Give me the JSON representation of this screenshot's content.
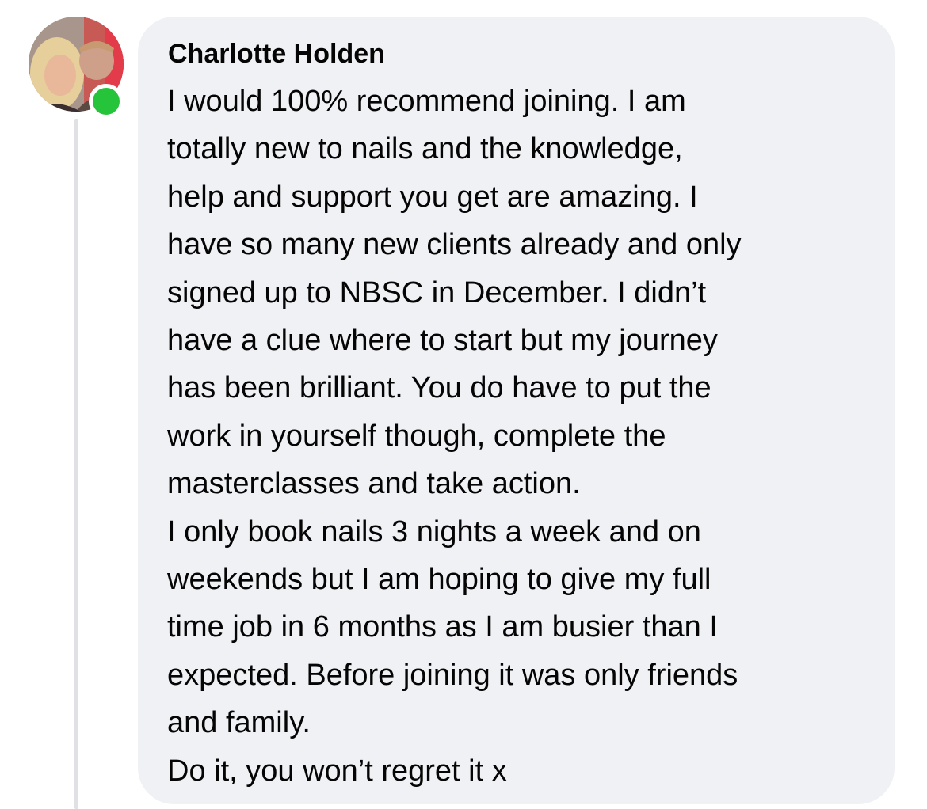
{
  "comment": {
    "author": "Charlotte Holden",
    "online": true,
    "presence_color": "#26c43a",
    "bubble_color": "#f0f1f4",
    "avatar_icon": "profile-photo-icon",
    "lines": [
      "I would 100% recommend joining. I am",
      "totally new to nails and the knowledge,",
      "help and support you get are amazing. I",
      "have so many new clients already and only",
      "signed up to NBSC in December. I didn’t",
      "have a clue where to start but my journey",
      "has been brilliant. You do have to put the",
      "work in yourself though, complete the",
      "masterclasses and take action.",
      "I only book nails 3 nights a week and on",
      "weekends but I am hoping to give my full",
      "time job in  6 months as I am busier than I",
      "expected. Before joining it was only friends",
      "and family.",
      "Do it, you won’t regret it x"
    ]
  }
}
